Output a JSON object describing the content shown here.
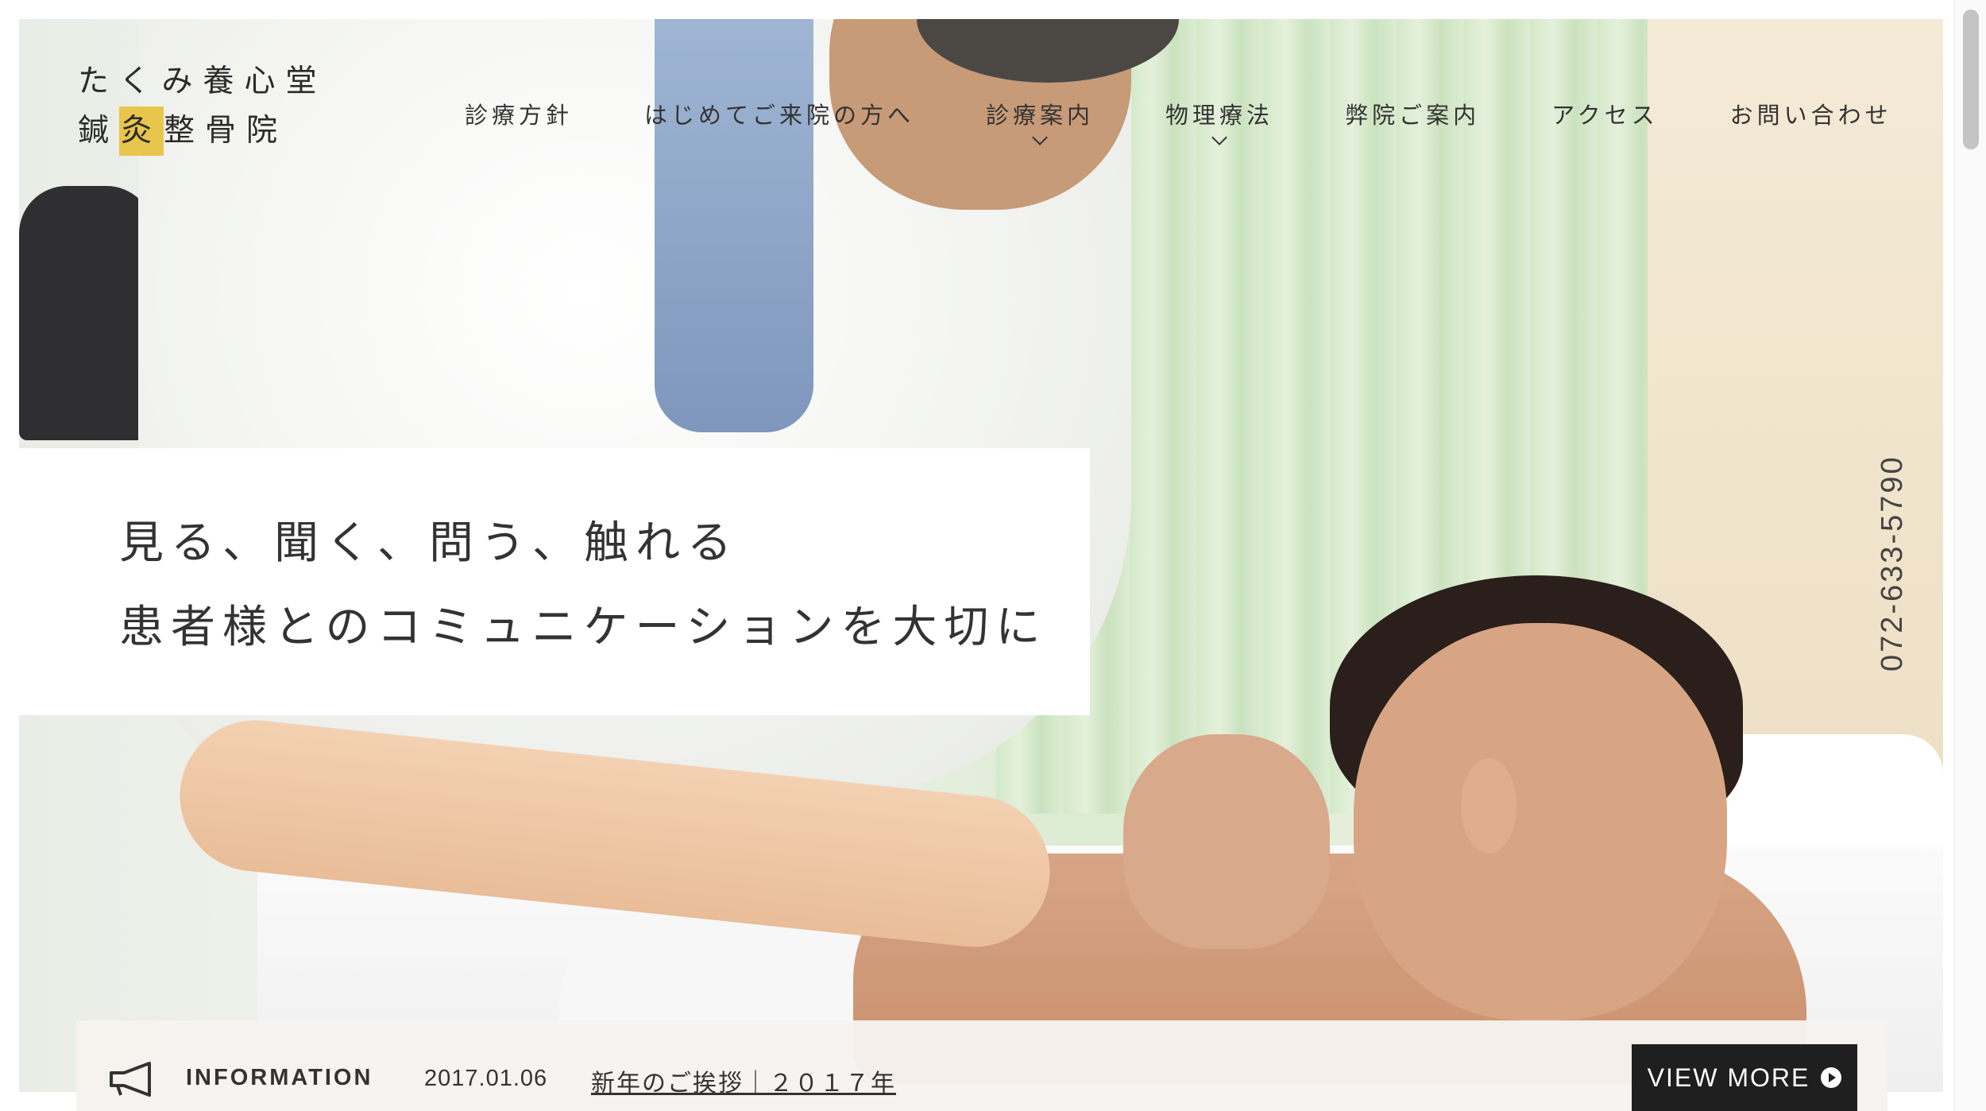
{
  "logo": {
    "line1": "たくみ養心堂",
    "line2_pre": "鍼",
    "line2_seal": "灸",
    "line2_post": "整骨院"
  },
  "nav": {
    "items": [
      {
        "label": "診療方針",
        "dropdown": false
      },
      {
        "label": "はじめてご来院の方へ",
        "dropdown": false
      },
      {
        "label": "診療案内",
        "dropdown": true
      },
      {
        "label": "物理療法",
        "dropdown": true
      },
      {
        "label": "弊院ご案内",
        "dropdown": false
      },
      {
        "label": "アクセス",
        "dropdown": false
      },
      {
        "label": "お問い合わせ",
        "dropdown": false
      }
    ]
  },
  "hero": {
    "slogan_line1": "見る、聞く、問う、触れる",
    "slogan_line2": "患者様とのコミュニケーションを大切に",
    "phone": "072-633-5790"
  },
  "info": {
    "icon": "megaphone-icon",
    "label": "INFORMATION",
    "date": "2017.01.06",
    "title": "新年のご挨拶｜２０１７年",
    "button_label": "VIEW MORE",
    "button_icon": "play-circle-icon"
  },
  "colors": {
    "accent": "#e8c54d",
    "button_bg": "#1f1f1f",
    "text": "#333333"
  }
}
